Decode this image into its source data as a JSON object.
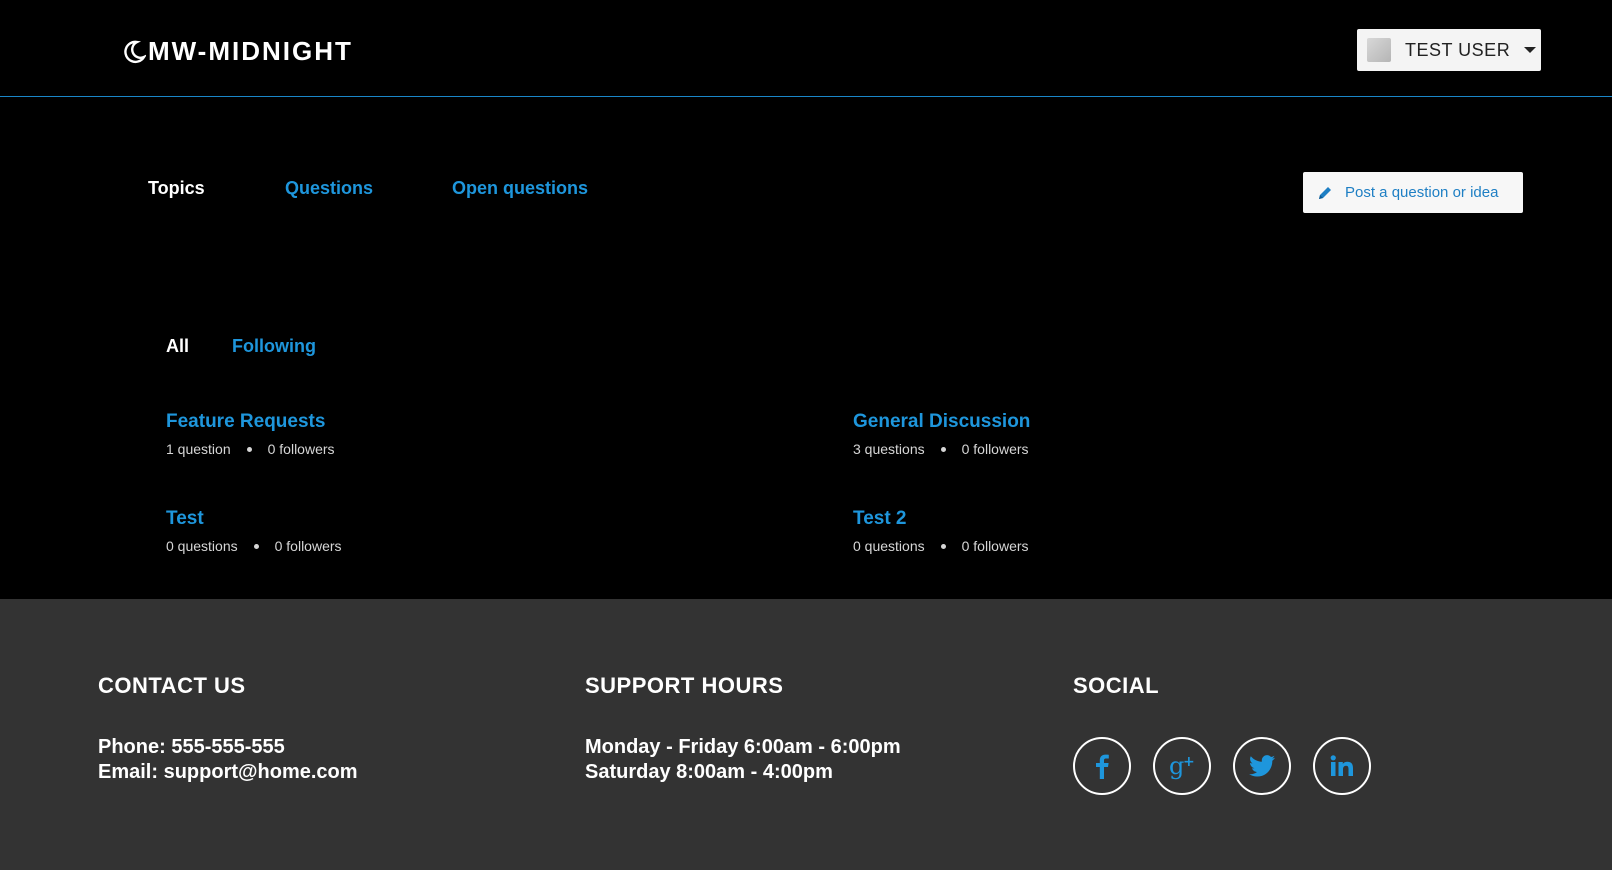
{
  "header": {
    "logo_text": "MW-MIDNIGHT",
    "user_name": "TEST USER"
  },
  "nav": {
    "tabs": [
      {
        "label": "Topics",
        "active": true
      },
      {
        "label": "Questions",
        "active": false
      },
      {
        "label": "Open questions",
        "active": false
      }
    ],
    "post_button_label": "Post a question or idea"
  },
  "filters": [
    {
      "label": "All",
      "active": true
    },
    {
      "label": "Following",
      "active": false
    }
  ],
  "topics": [
    {
      "title": "Feature Requests",
      "questions": "1 question",
      "followers": "0 followers"
    },
    {
      "title": "General Discussion",
      "questions": "3 questions",
      "followers": "0 followers"
    },
    {
      "title": "Test",
      "questions": "0 questions",
      "followers": "0 followers"
    },
    {
      "title": "Test 2",
      "questions": "0 questions",
      "followers": "0 followers"
    }
  ],
  "footer": {
    "contact": {
      "heading": "CONTACT US",
      "phone": "Phone: 555-555-555",
      "email": "Email: support@home.com"
    },
    "hours": {
      "heading": "SUPPORT HOURS",
      "weekday": "Monday - Friday 6:00am - 6:00pm",
      "saturday": "Saturday 8:00am - 4:00pm"
    },
    "social": {
      "heading": "SOCIAL",
      "icons": [
        "facebook-icon",
        "google-plus-icon",
        "twitter-icon",
        "linkedin-icon"
      ]
    }
  },
  "colors": {
    "accent": "#1e96dc",
    "background": "#000000",
    "footer_bg": "#333333",
    "header_border": "#1a86c8"
  }
}
